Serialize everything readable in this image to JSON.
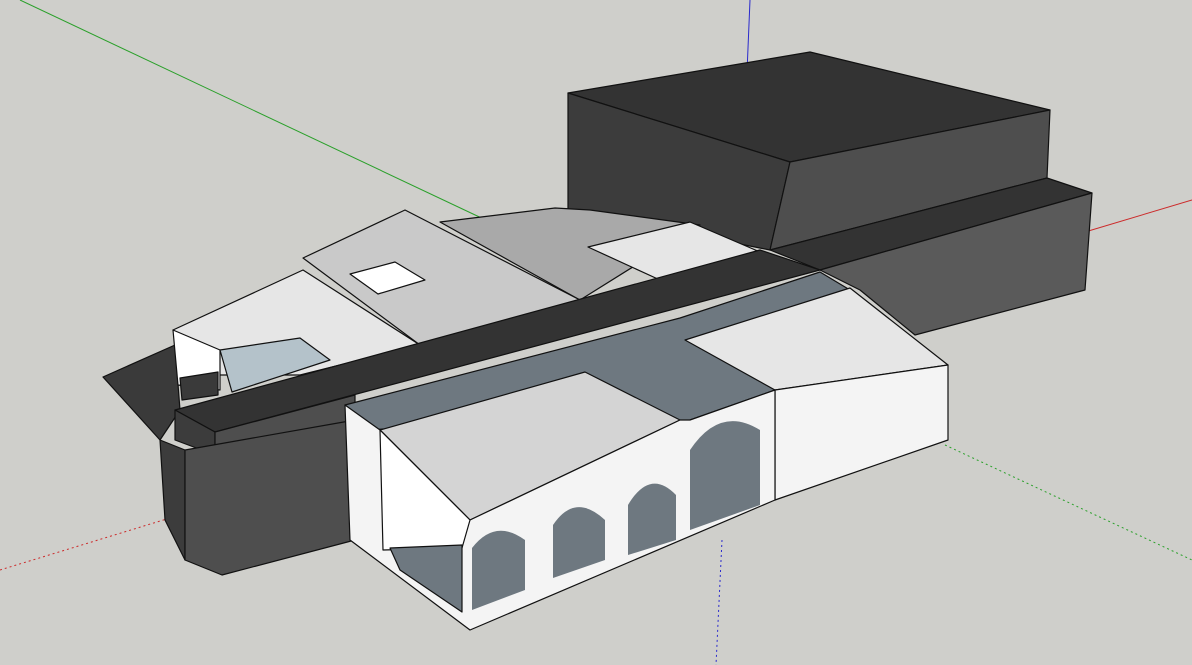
{
  "viewport": {
    "background": "#cfcfcb",
    "axes": {
      "red": "#cc2a2a",
      "green": "#2aa02a",
      "blue": "#2a2acc"
    }
  },
  "model": {
    "colors": {
      "dark_face": "#3c3c3c",
      "dark_side": "#4e4e4e",
      "dark_side_light": "#5a5a5a",
      "dark_top": "#333333",
      "light_face": "#e6e6e6",
      "light_face_shade": "#d4d4d4",
      "white_face": "#f4f4f4",
      "roof_grey": "#a9a9a9",
      "roof_light": "#c9c9c9",
      "inset_blue_grey": "#6e7880",
      "shadow": "#3a3a3a",
      "glass": "#b4c2ca"
    }
  }
}
